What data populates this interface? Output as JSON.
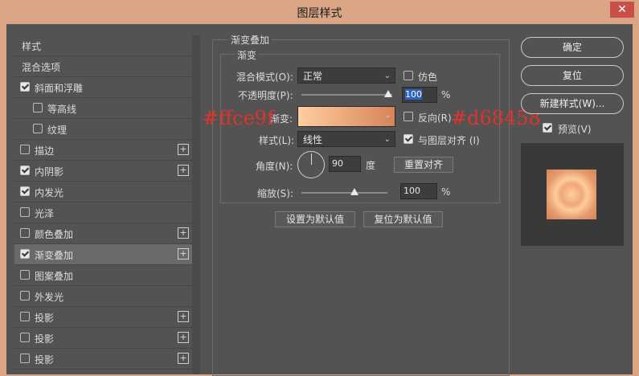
{
  "window": {
    "title": "图层样式",
    "close_glyph": "✕"
  },
  "sidebar": {
    "items": [
      {
        "label": "样式",
        "checkbox": false,
        "checked": false,
        "plus": false,
        "selected": false
      },
      {
        "label": "混合选项",
        "checkbox": false,
        "checked": false,
        "plus": false,
        "selected": false
      },
      {
        "label": "斜面和浮雕",
        "checkbox": true,
        "checked": true,
        "plus": false,
        "selected": false
      },
      {
        "label": "等高线",
        "checkbox": true,
        "checked": false,
        "plus": false,
        "selected": false
      },
      {
        "label": "纹理",
        "checkbox": true,
        "checked": false,
        "plus": false,
        "selected": false
      },
      {
        "label": "描边",
        "checkbox": true,
        "checked": false,
        "plus": true,
        "selected": false
      },
      {
        "label": "内阴影",
        "checkbox": true,
        "checked": true,
        "plus": true,
        "selected": false
      },
      {
        "label": "内发光",
        "checkbox": true,
        "checked": true,
        "plus": false,
        "selected": false
      },
      {
        "label": "光泽",
        "checkbox": true,
        "checked": false,
        "plus": false,
        "selected": false
      },
      {
        "label": "颜色叠加",
        "checkbox": true,
        "checked": false,
        "plus": true,
        "selected": false
      },
      {
        "label": "渐变叠加",
        "checkbox": true,
        "checked": true,
        "plus": true,
        "selected": true
      },
      {
        "label": "图案叠加",
        "checkbox": true,
        "checked": false,
        "plus": false,
        "selected": false
      },
      {
        "label": "外发光",
        "checkbox": true,
        "checked": false,
        "plus": false,
        "selected": false
      },
      {
        "label": "投影",
        "checkbox": true,
        "checked": false,
        "plus": true,
        "selected": false
      },
      {
        "label": "投影",
        "checkbox": true,
        "checked": false,
        "plus": true,
        "selected": false
      },
      {
        "label": "投影",
        "checkbox": true,
        "checked": false,
        "plus": true,
        "selected": false
      }
    ],
    "plus_glyph": "+"
  },
  "panel": {
    "section_title": "渐变叠加",
    "sub_title": "渐变",
    "blend_mode_label": "混合模式(O):",
    "blend_mode_value": "正常",
    "dither_label": "仿色",
    "opacity_label": "不透明度(P):",
    "opacity_value": "100",
    "opacity_unit": "%",
    "gradient_label": "渐变:",
    "reverse_label": "反向(R)",
    "style_label": "样式(L):",
    "style_value": "线性",
    "align_label": "与图层对齐 (I)",
    "angle_label": "角度(N):",
    "angle_value": "90",
    "angle_unit": "度",
    "reset_align_button": "重置对齐",
    "scale_label": "缩放(S):",
    "scale_value": "100",
    "scale_unit": "%",
    "set_default_button": "设置为默认值",
    "reset_default_button": "复位为默认值"
  },
  "gradient": {
    "start_color": "#ffce9f",
    "end_color": "#d68458"
  },
  "annotations": {
    "left": "#ffce9f",
    "right": "#d68458"
  },
  "right": {
    "ok_button": "确定",
    "reset_button": "复位",
    "new_style_button": "新建样式(W)...",
    "preview_label": "预览(V)",
    "arrow_glyph": "⌄"
  }
}
